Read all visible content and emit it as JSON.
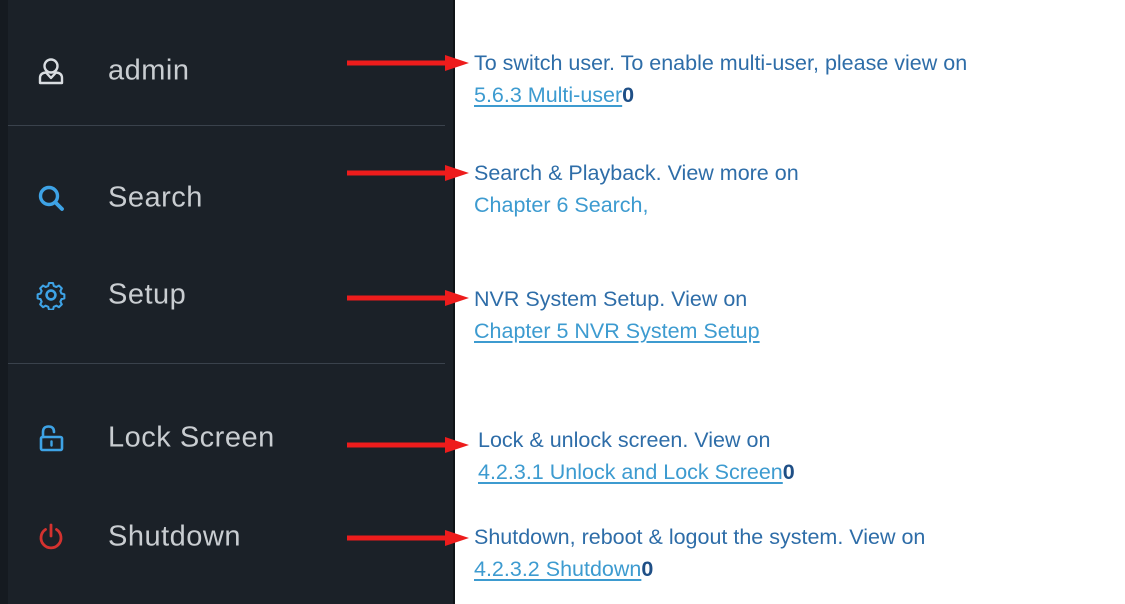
{
  "menu": {
    "items": [
      {
        "label": "admin",
        "icon": "user-icon"
      },
      {
        "label": "Search",
        "icon": "search-icon"
      },
      {
        "label": "Setup",
        "icon": "gear-icon"
      },
      {
        "label": "Lock Screen",
        "icon": "lock-icon"
      },
      {
        "label": "Shutdown",
        "icon": "power-icon"
      }
    ]
  },
  "annotations": [
    {
      "desc": "To switch user. To enable multi-user, please view on",
      "link": "5.6.3 Multi-user",
      "suffix": "0"
    },
    {
      "desc": "Search & Playback. View more on",
      "link": "Chapter 6 Search,",
      "suffix": ""
    },
    {
      "desc": "NVR System Setup. View on",
      "link": "Chapter 5 NVR System Setup",
      "suffix": ""
    },
    {
      "desc": "Lock & unlock screen. View on",
      "link": "4.2.3.1 Unlock and Lock Screen",
      "suffix": "0"
    },
    {
      "desc": "Shutdown, reboot & logout the system. View on",
      "link": "4.2.3.2 Shutdown",
      "suffix": "0"
    }
  ],
  "colors": {
    "panel_bg": "#1b2128",
    "menu_text": "#c9cdd1",
    "icon_blue": "#3ea3e6",
    "icon_white": "#d9dde1",
    "icon_red": "#d4322f",
    "arrow_red": "#ee1c1c",
    "desc_text": "#2e6da8",
    "link_text": "#3d9bd0"
  }
}
